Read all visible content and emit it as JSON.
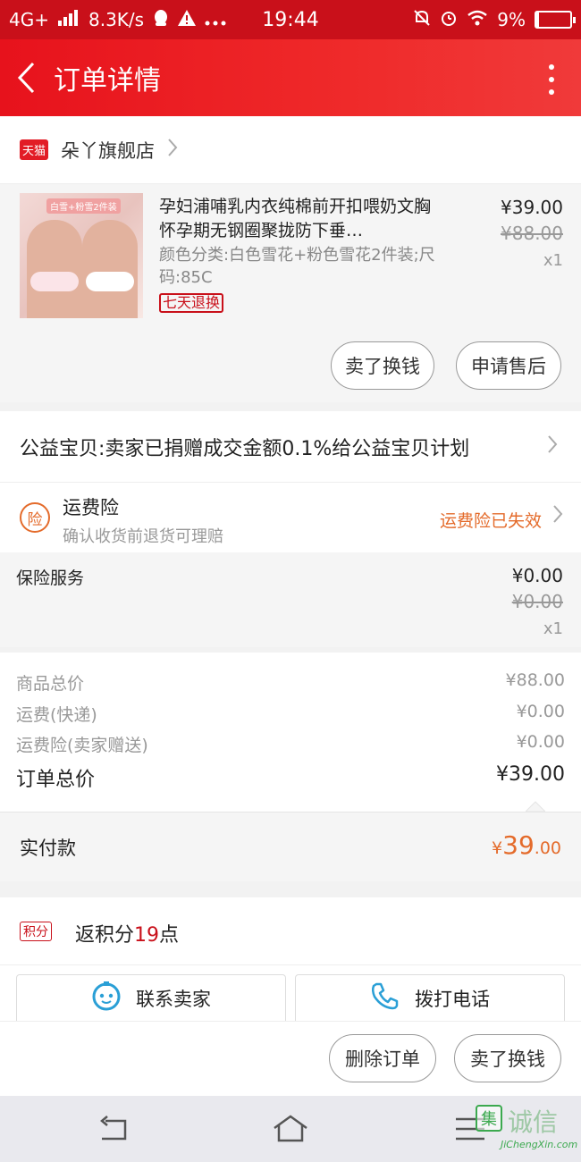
{
  "status_bar": {
    "network": "4G+",
    "speed": "8.3K/s",
    "time": "19:44",
    "battery": "9%",
    "battery_level": 0.09
  },
  "header": {
    "title": "订单详情"
  },
  "shop": {
    "badge": "天猫",
    "name": "朵丫旗舰店"
  },
  "product": {
    "image_tag": "白雪+粉雪2件装",
    "title": "孕妇浦哺乳内衣纯棉前开扣喂奶文胸怀孕期无钢圈聚拢防下垂…",
    "spec": "颜色分类:白色雪花+粉色雪花2件装;尺码:85C",
    "return_badge": "七天退换",
    "price": "¥39.00",
    "original_price": "¥88.00",
    "qty": "x1",
    "buttons": {
      "sell": "卖了换钱",
      "after_sale": "申请售后"
    }
  },
  "charity": {
    "text": "公益宝贝:卖家已捐赠成交金额0.1%给公益宝贝计划"
  },
  "insurance": {
    "icon": "险",
    "title": "运费险",
    "subtitle": "确认收货前退货可理赔",
    "status": "运费险已失效"
  },
  "service": {
    "label": "保险服务",
    "price": "¥0.00",
    "original_price": "¥0.00",
    "qty": "x1"
  },
  "totals": {
    "goods_label": "商品总价",
    "goods_value": "¥88.00",
    "shipping_label": "运费(快递)",
    "shipping_value": "¥0.00",
    "insurance_label": "运费险(卖家赠送)",
    "insurance_value": "¥0.00",
    "order_label": "订单总价",
    "order_value": "¥39.00"
  },
  "paid": {
    "label": "实付款",
    "yen": "¥",
    "int": "39",
    "dec": ".00"
  },
  "points": {
    "badge": "积分",
    "prefix": "返积分",
    "value": "19",
    "suffix": "点"
  },
  "contact": {
    "seller": "联系卖家",
    "call": "拨打电话"
  },
  "actions": {
    "delete": "删除订单",
    "sell": "卖了换钱"
  },
  "watermark": {
    "logo": "集",
    "name": "诚信",
    "url": "JiChengXin.com"
  },
  "colors": {
    "brand_red": "#c9101a",
    "accent_orange": "#e46b2b",
    "link_blue": "#2a9fd6"
  }
}
